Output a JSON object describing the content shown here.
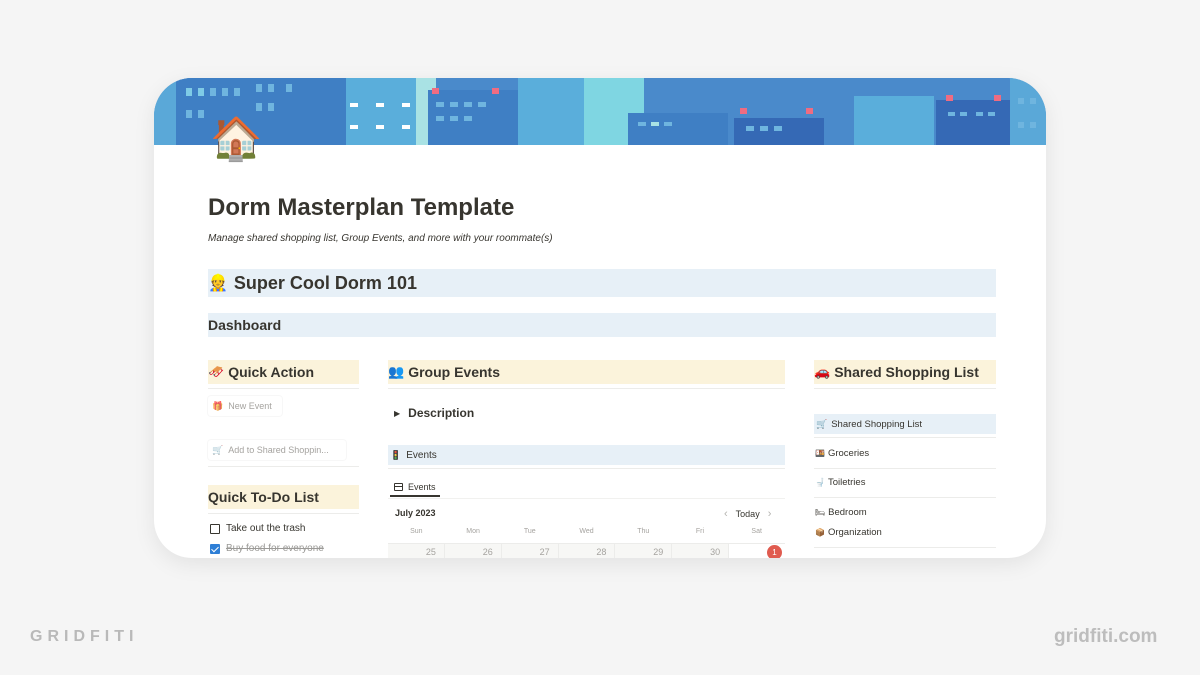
{
  "page": {
    "icon": "🏠",
    "title": "Dorm Masterplan Template",
    "subtitle": "Manage shared shopping list, Group Events, and more with your roommate(s)"
  },
  "heading1": {
    "emoji": "👷",
    "text": "Super Cool Dorm 101"
  },
  "heading2": {
    "text": "Dashboard"
  },
  "quick_action": {
    "emoji": "🛷",
    "title": "Quick Action",
    "buttons": [
      {
        "emoji": "🎁",
        "label": "New Event"
      },
      {
        "emoji": "🛒",
        "label": "Add to Shared Shoppin..."
      }
    ]
  },
  "todo": {
    "title": "Quick To-Do List",
    "items": [
      {
        "label": "Take out the trash",
        "checked": false
      },
      {
        "label": "Buy food for everyone",
        "checked": true
      }
    ]
  },
  "group_events": {
    "emoji": "👥",
    "title": "Group Events",
    "toggle_label": "Description",
    "database": {
      "emoji": "🚦",
      "title": "Events"
    },
    "view_tab": "Events",
    "calendar": {
      "month": "July 2023",
      "today_label": "Today",
      "prev_icon": "‹",
      "next_icon": "›",
      "weekdays": [
        "Sun",
        "Mon",
        "Tue",
        "Wed",
        "Thu",
        "Fri",
        "Sat"
      ],
      "first_row": [
        "25",
        "26",
        "27",
        "28",
        "29",
        "30",
        "1"
      ],
      "today_date": "1"
    }
  },
  "shopping": {
    "emoji": "🚗",
    "title": "Shared Shopping List",
    "database": {
      "emoji": "🛒",
      "title": "Shared Shopping List"
    },
    "groups": [
      {
        "emoji": "🍱",
        "label": "Groceries"
      },
      {
        "emoji": "🚽",
        "label": "Toiletries"
      },
      {
        "emoji": "🛏",
        "label": "Bedroom"
      },
      {
        "emoji": "📦",
        "label": "Organization"
      }
    ]
  },
  "watermark": {
    "left": "GRIDFITI",
    "right": "gridfiti.com"
  },
  "colors": {
    "cover_blue": "#4a8acb",
    "heading_blue_bg": "#e7f0f7",
    "heading_yellow_bg": "#fbf3db",
    "today_red": "#e05b4f",
    "checkbox_blue": "#2e7fd6"
  }
}
